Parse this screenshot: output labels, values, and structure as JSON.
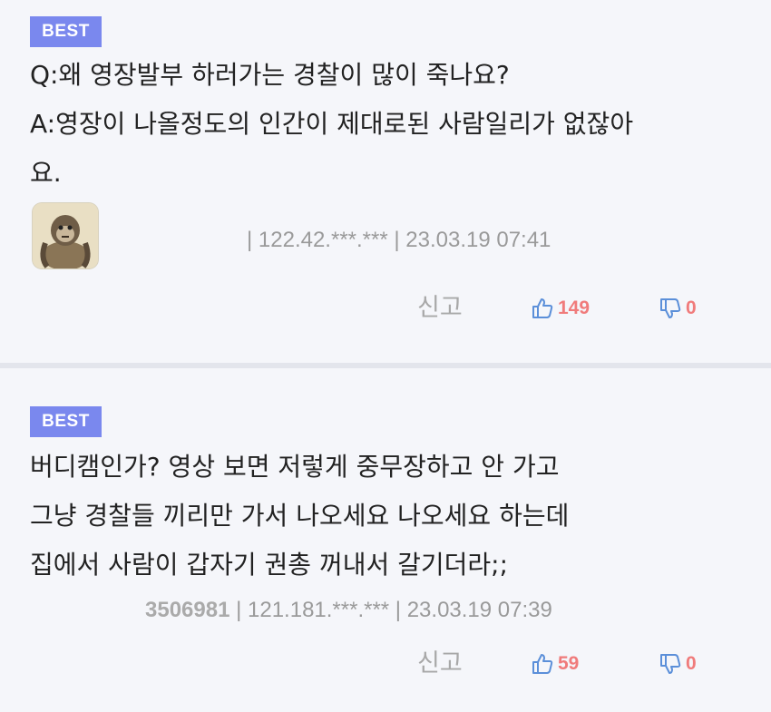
{
  "comments": [
    {
      "badge": "BEST",
      "lines": [
        "Q:왜 영장발부 하러가는 경찰이 많이 죽나요?",
        "A:영장이 나올정도의 인간이 제대로된 사람일리가 없잖아",
        "요."
      ],
      "author_id": "",
      "meta": "| 122.42.***.*** | 23.03.19 07:41",
      "report_label": "신고",
      "upvotes": "149",
      "downvotes": "0",
      "avatar": "gorilla-avatar"
    },
    {
      "badge": "BEST",
      "lines": [
        "버디캠인가? 영상 보면 저렇게 중무장하고 안 가고",
        "그냥 경찰들 끼리만 가서 나오세요 나오세요 하는데",
        "집에서 사람이 갑자기 권총 꺼내서 갈기더라;;"
      ],
      "author_id": "3506981",
      "meta": " | 121.181.***.*** | 23.03.19 07:39",
      "report_label": "신고",
      "upvotes": "59",
      "downvotes": "0"
    }
  ],
  "colors": {
    "badge": "#7a88ee",
    "thumbs_icon": "#5b8fd9",
    "vote_count": "#f07b7b",
    "background": "#f5f6fa"
  }
}
